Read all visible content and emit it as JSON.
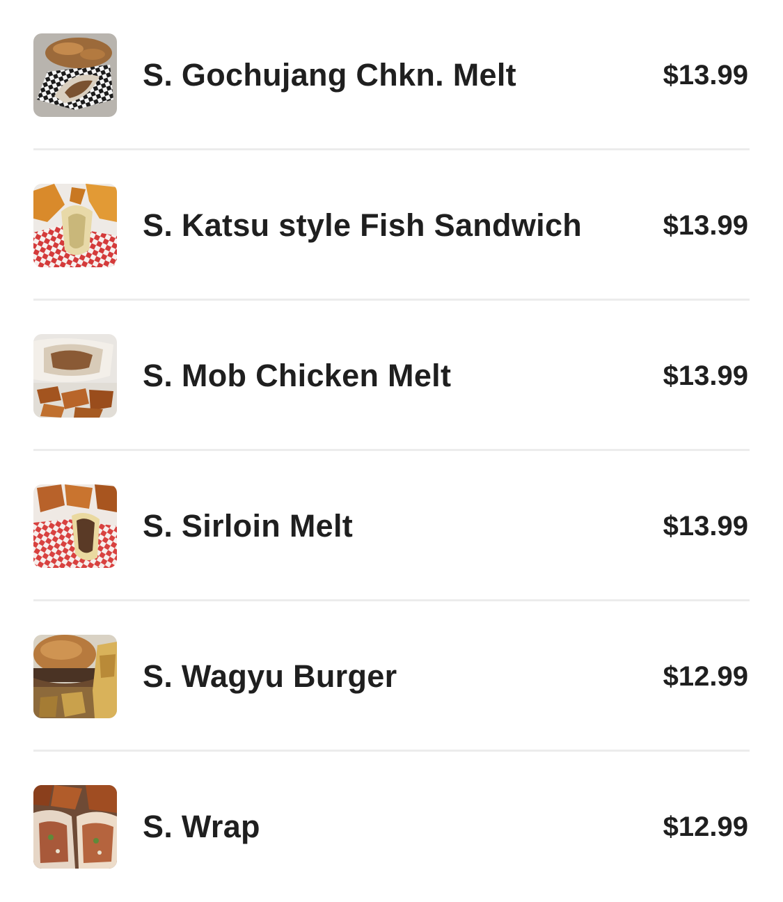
{
  "menu": {
    "items": [
      {
        "name": "S. Gochujang Chkn. Melt",
        "price": "$13.99",
        "image": "gochujang-chicken-melt-photo"
      },
      {
        "name": "S. Katsu style Fish Sandwich",
        "price": "$13.99",
        "image": "katsu-fish-sandwich-photo"
      },
      {
        "name": "S. Mob Chicken Melt",
        "price": "$13.99",
        "image": "mob-chicken-melt-photo"
      },
      {
        "name": "S. Sirloin Melt",
        "price": "$13.99",
        "image": "sirloin-melt-photo"
      },
      {
        "name": "S. Wagyu Burger",
        "price": "$12.99",
        "image": "wagyu-burger-photo"
      },
      {
        "name": "S. Wrap",
        "price": "$12.99",
        "image": "wrap-photo"
      }
    ]
  }
}
